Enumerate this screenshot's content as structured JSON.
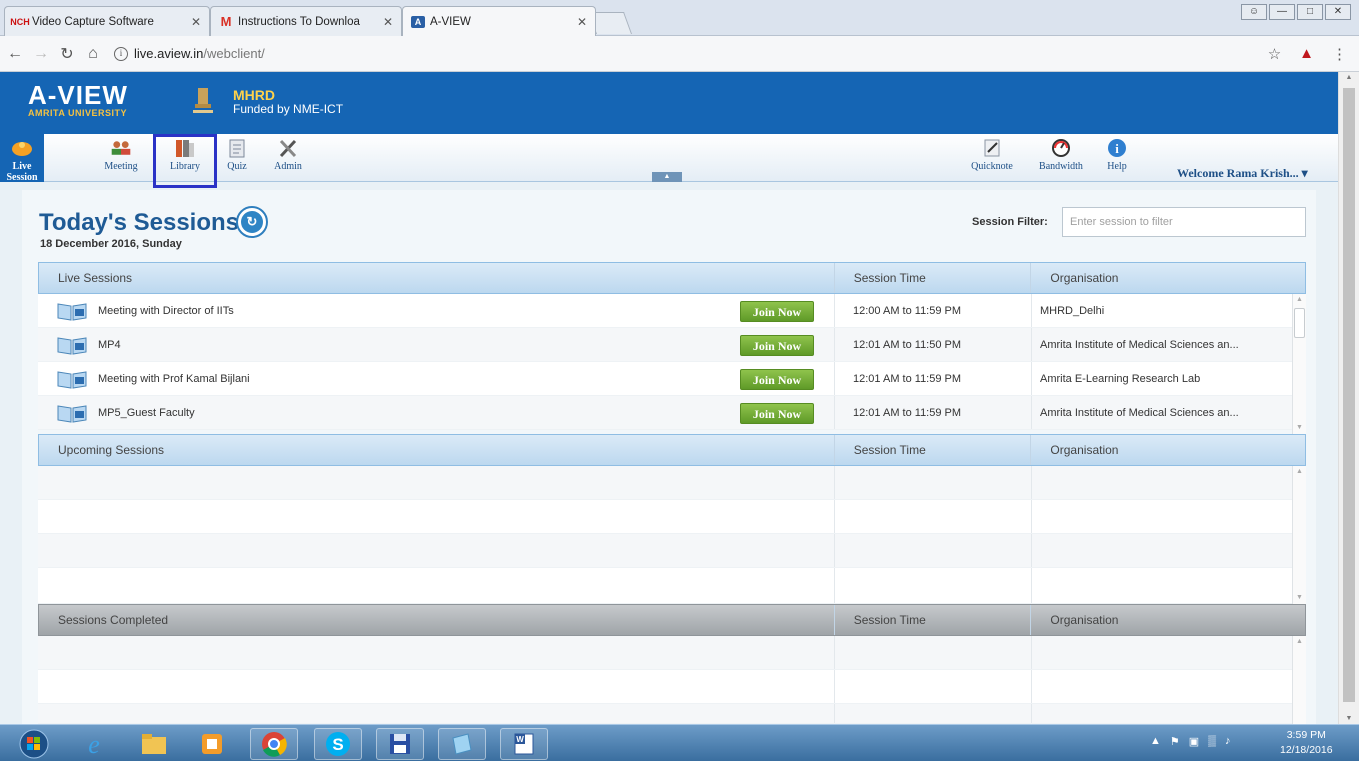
{
  "browser": {
    "tabs": [
      {
        "label": "Video Capture Software",
        "favicon": "NCH"
      },
      {
        "label": "Instructions To Downloa",
        "favicon": "M"
      },
      {
        "label": "A-VIEW",
        "favicon": "A"
      }
    ],
    "url": "live.aview.in/webclient/",
    "url_host": "live.aview.in",
    "url_path": "/webclient/"
  },
  "header": {
    "logo": "A-VIEW",
    "logo_sub": "AMRITA UNIVERSITY",
    "org_title": "MHRD",
    "org_sub": "Funded by NME-ICT"
  },
  "toolbar": {
    "left": [
      "Live Session",
      "Meeting",
      "Library",
      "Quiz",
      "Admin"
    ],
    "right": [
      "Quicknote",
      "Bandwidth",
      "Help"
    ],
    "welcome": "Welcome Rama Krish... ▾"
  },
  "page": {
    "title": "Today's Sessions",
    "date": "18 December 2016, Sunday",
    "filter_label": "Session Filter:",
    "filter_placeholder": "Enter session to filter"
  },
  "live": {
    "headers": [
      "Live Sessions",
      "Session Time",
      "Organisation"
    ],
    "join_label": "Join Now",
    "rows": [
      {
        "name": "Meeting with Director of IITs",
        "time": "12:00 AM  to 11:59 PM",
        "org": "MHRD_Delhi"
      },
      {
        "name": "MP4",
        "time": "12:01 AM  to 11:50 PM",
        "org": "Amrita Institute of Medical Sciences an..."
      },
      {
        "name": "Meeting with Prof Kamal Bijlani",
        "time": "12:01 AM  to 11:59 PM",
        "org": "Amrita E-Learning Research Lab"
      },
      {
        "name": "MP5_Guest Faculty",
        "time": "12:01 AM  to 11:59 PM",
        "org": "Amrita Institute of Medical Sciences an..."
      }
    ]
  },
  "upcoming": {
    "headers": [
      "Upcoming Sessions",
      "Session Time",
      "Organisation"
    ]
  },
  "completed": {
    "headers": [
      "Sessions Completed",
      "Session Time",
      "Organisation"
    ]
  },
  "taskbar": {
    "time": "3:59 PM",
    "date": "12/18/2016"
  },
  "colors": {
    "header_blue": "#1565b4",
    "join_green": "#6ea834",
    "title_blue": "#1f5b95"
  }
}
